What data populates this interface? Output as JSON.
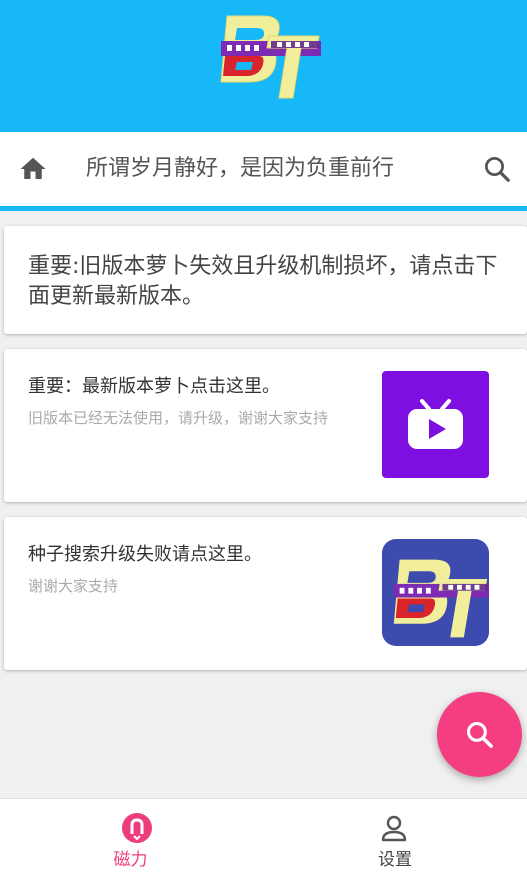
{
  "header": {
    "logo_text": "BT",
    "background_color": "#16b8f7"
  },
  "search_bar": {
    "home_icon": "home-icon",
    "slogan": "所谓岁月静好，是因为负重前行",
    "search_icon": "search-icon"
  },
  "notice": {
    "text": "重要:旧版本萝卜失效且升级机制损坏，请点击下面更新最新版本。"
  },
  "cards": [
    {
      "title": "重要：最新版本萝卜点击这里。",
      "subtitle": "旧版本已经无法使用，请升级，谢谢大家支持",
      "thumb_icon": "tv-play-icon"
    },
    {
      "title": "种子搜索升级失败请点这里。",
      "subtitle": "谢谢大家支持",
      "thumb_icon": "bt-logo-icon"
    }
  ],
  "fab": {
    "icon": "search-icon",
    "color": "#f53d82"
  },
  "bottom_nav": {
    "items": [
      {
        "label": "磁力",
        "icon": "magnet-icon",
        "active": true,
        "color": "#ee3d7d"
      },
      {
        "label": "设置",
        "icon": "person-icon",
        "active": false,
        "color": "#444444"
      }
    ]
  }
}
